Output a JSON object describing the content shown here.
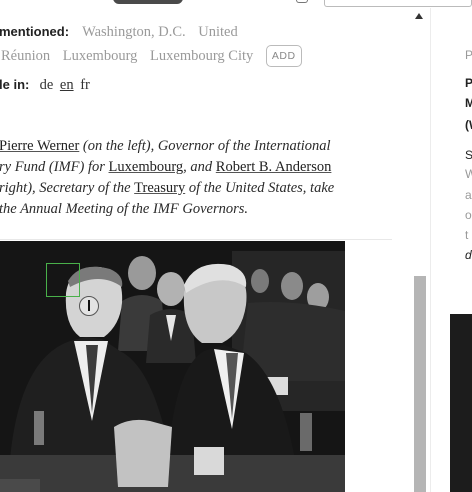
{
  "toolbar": {
    "tab_color": "#4a4a4a"
  },
  "meta": {
    "mentioned_label": "mentioned:",
    "places": [
      "Washington, D.C.",
      "United",
      "Réunion",
      "Luxembourg",
      "Luxembourg City"
    ],
    "add_label": "ADD",
    "languages_label": "le in:",
    "languages": [
      "de",
      "en",
      "fr"
    ],
    "active_language": "en"
  },
  "caption": {
    "l1_link": "Pierre Werner",
    "l1_text": " (on the left), Governor of the International",
    "l2_text_a": "ry Fund (IMF) for ",
    "l2_link": "Luxembourg",
    "l2_text_b": ", and ",
    "l2_link2": "Robert B. Anderson",
    "l3_text_a": "right), Secretary of the ",
    "l3_link": "Treasury",
    "l3_text_b": " of the United States, take",
    "l4_text": "the Annual Meeting of the IMF Governors."
  },
  "sidebar": {
    "lines": [
      "P",
      "P",
      "M",
      "(W",
      "S",
      "W",
      "a",
      "o",
      "t",
      "d"
    ]
  },
  "colors": {
    "selection_box": "#49b04a",
    "muted_text": "#9a9a9a",
    "scrollbar_thumb": "#b5b5b5"
  },
  "icons": {
    "scroll_up": "triangle-up",
    "cursor": "ibeam-cursor"
  }
}
